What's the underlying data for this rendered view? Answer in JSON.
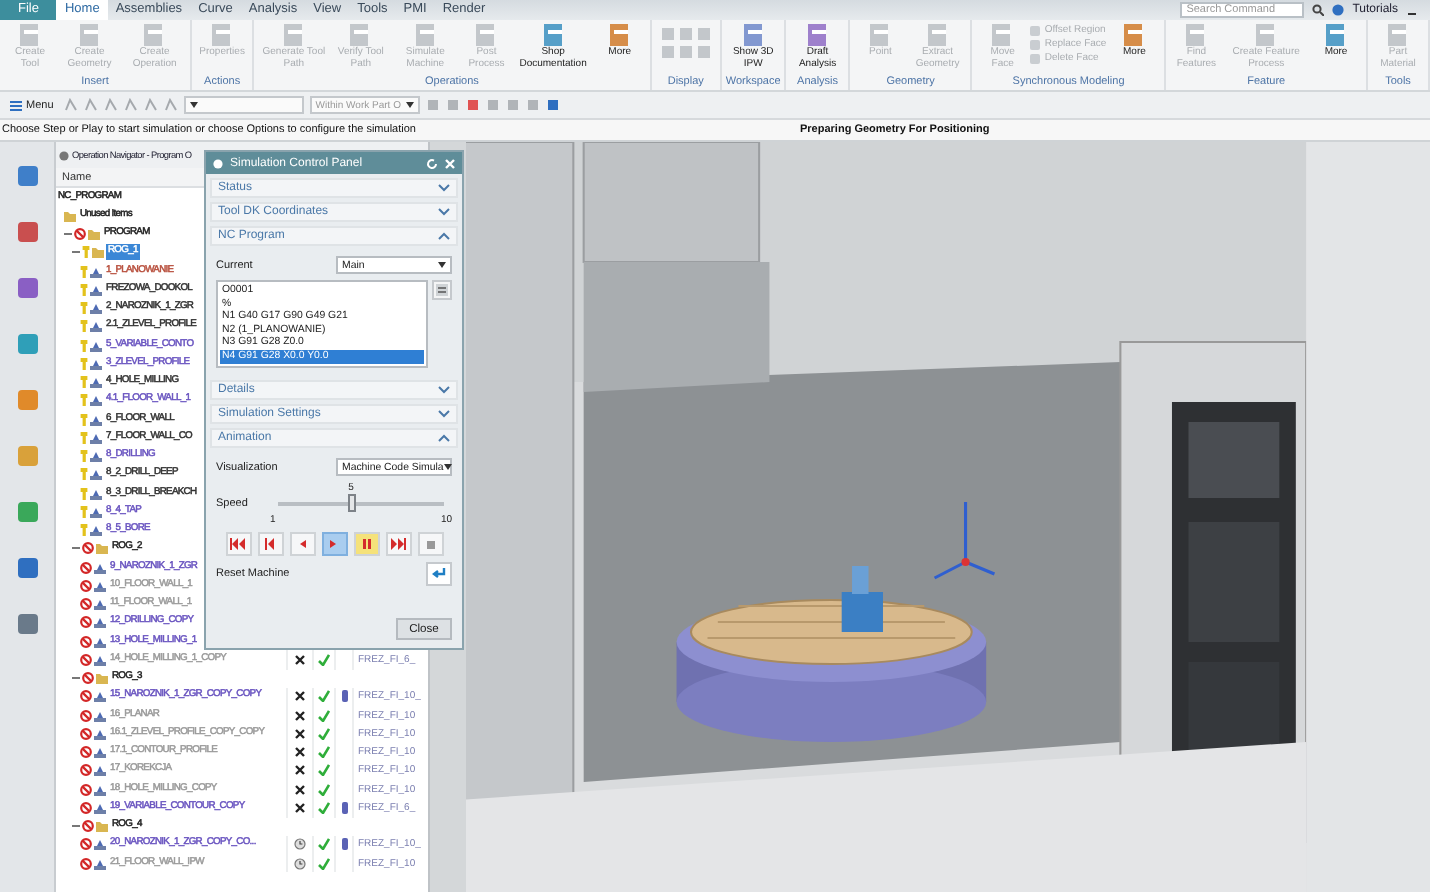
{
  "menu_tabs": [
    {
      "label": "File",
      "kind": "file",
      "selected": false
    },
    {
      "label": "Home",
      "kind": "tab",
      "selected": true
    },
    {
      "label": "Assemblies",
      "kind": "tab",
      "selected": false
    },
    {
      "label": "Curve",
      "kind": "tab",
      "selected": false
    },
    {
      "label": "Analysis",
      "kind": "tab",
      "selected": false
    },
    {
      "label": "View",
      "kind": "tab",
      "selected": false
    },
    {
      "label": "Tools",
      "kind": "tab",
      "selected": false
    },
    {
      "label": "PMI",
      "kind": "tab",
      "selected": false
    },
    {
      "label": "Render",
      "kind": "tab",
      "selected": false
    }
  ],
  "search": {
    "placeholder": "Search Command"
  },
  "user_menu": "Tutorials",
  "ribbon": {
    "groups": [
      {
        "label": "Insert",
        "buttons": [
          {
            "label": "Create Tool",
            "kind": "large",
            "disabled": true
          },
          {
            "label": "Create Geometry",
            "kind": "large",
            "disabled": true
          },
          {
            "label": "Create Operation",
            "kind": "large",
            "disabled": true
          }
        ]
      },
      {
        "label": "Actions",
        "buttons": [
          {
            "label": "Properties",
            "kind": "large",
            "disabled": true
          }
        ]
      },
      {
        "label": "Operations",
        "buttons": [
          {
            "label": "Generate Tool Path",
            "kind": "large",
            "disabled": true
          },
          {
            "label": "Verify Tool Path",
            "kind": "large",
            "disabled": true
          },
          {
            "label": "Simulate Machine",
            "kind": "large",
            "disabled": true
          },
          {
            "label": "Post Process",
            "kind": "large",
            "disabled": true
          },
          {
            "label": "Shop Documentation",
            "kind": "large",
            "disabled": false
          },
          {
            "label": "More",
            "kind": "large",
            "disabled": false
          }
        ]
      },
      {
        "label": "Display"
      },
      {
        "label": "Workspace",
        "buttons": [
          {
            "label": "Show 3D IPW",
            "kind": "large",
            "disabled": false
          }
        ]
      },
      {
        "label": "Analysis",
        "buttons": [
          {
            "label": "Draft Analysis",
            "kind": "large",
            "disabled": false
          }
        ]
      },
      {
        "label": "Geometry",
        "buttons": [
          {
            "label": "Point",
            "kind": "large",
            "disabled": true
          },
          {
            "label": "Extract Geometry",
            "kind": "large",
            "disabled": true
          }
        ]
      },
      {
        "label": "Synchronous Modeling",
        "buttons": [
          {
            "label": "Move Face",
            "kind": "large",
            "disabled": true
          },
          {
            "label": "Offset Region",
            "kind": "small",
            "disabled": true
          },
          {
            "label": "Replace Face",
            "kind": "small",
            "disabled": true
          },
          {
            "label": "Delete Face",
            "kind": "small",
            "disabled": true
          },
          {
            "label": "More",
            "kind": "large",
            "disabled": false
          }
        ]
      },
      {
        "label": "Feature",
        "buttons": [
          {
            "label": "Find Features",
            "kind": "large",
            "disabled": true
          },
          {
            "label": "Create Feature Process",
            "kind": "large",
            "disabled": true
          },
          {
            "label": "More",
            "kind": "large",
            "disabled": false
          }
        ]
      },
      {
        "label": "Tools",
        "buttons": [
          {
            "label": "Part Material",
            "kind": "large",
            "disabled": true
          }
        ]
      }
    ]
  },
  "toolbar": {
    "menu": "Menu",
    "filter": "Within Work Part O"
  },
  "status_bar": {
    "prompt": "Choose Step or Play to start simulation or choose Options to configure the simulation",
    "status": "Preparing Geometry For Positioning"
  },
  "navigator": {
    "title": "Operation Navigator - Program O",
    "column": "Name",
    "tree": [
      {
        "name": "NC_PROGRAM",
        "selected": false,
        "children": [
          {
            "name": "Unused Items",
            "kind": "folder",
            "selected": false
          },
          {
            "name": "PROGRAM",
            "kind": "folder",
            "failed": true,
            "expanded": true,
            "selected": false,
            "children": [
              {
                "name": "ROG_1",
                "kind": "group",
                "failed": false,
                "expanded": true,
                "selected": true,
                "children": [
                  {
                    "name": "1_PLANOWANIE",
                    "kind": "op",
                    "failed": false,
                    "color": "#b8503e",
                    "selected": false
                  },
                  {
                    "name": "FREZOWA_DOOKOL",
                    "kind": "op",
                    "failed": false,
                    "color": "#333333",
                    "selected": false
                  },
                  {
                    "name": "2_NAROZNIK_1_ZGR",
                    "kind": "op",
                    "failed": false,
                    "color": "#333333",
                    "selected": false
                  },
                  {
                    "name": "2.1_ZLEVEL_PROFILE",
                    "kind": "op",
                    "failed": false,
                    "color": "#333333",
                    "selected": false
                  },
                  {
                    "name": "5_VARIABLE_CONTO",
                    "kind": "op",
                    "failed": false,
                    "color": "#6a55c0",
                    "selected": false
                  },
                  {
                    "name": "3_ZLEVEL_PROFILE",
                    "kind": "op",
                    "failed": false,
                    "color": "#6a55c0",
                    "selected": false
                  },
                  {
                    "name": "4_HOLE_MILLING",
                    "kind": "op",
                    "failed": false,
                    "color": "#333333",
                    "selected": false
                  },
                  {
                    "name": "4.1_FLOOR_WALL_1",
                    "kind": "op",
                    "failed": false,
                    "color": "#6a55c0",
                    "selected": false
                  },
                  {
                    "name": "6_FLOOR_WALL",
                    "kind": "op",
                    "failed": false,
                    "color": "#333333",
                    "selected": false
                  },
                  {
                    "name": "7_FLOOR_WALL_CO",
                    "kind": "op",
                    "failed": false,
                    "color": "#333333",
                    "selected": false
                  },
                  {
                    "name": "8_DRILLING",
                    "kind": "op",
                    "failed": false,
                    "color": "#6a55c0",
                    "selected": false
                  },
                  {
                    "name": "8_2_DRILL_DEEP",
                    "kind": "op",
                    "failed": false,
                    "color": "#333333",
                    "selected": false
                  },
                  {
                    "name": "8_3_DRILL_BREAKCH",
                    "kind": "op",
                    "failed": false,
                    "color": "#333333",
                    "selected": false
                  },
                  {
                    "name": "8_4_TAP",
                    "kind": "op",
                    "failed": false,
                    "color": "#6a55c0",
                    "selected": false
                  },
                  {
                    "name": "8_5_BORE",
                    "kind": "op",
                    "failed": false,
                    "color": "#6a55c0",
                    "selected": false
                  }
                ]
              },
              {
                "name": "ROG_2",
                "kind": "group",
                "failed": true,
                "expanded": true,
                "selected": false,
                "children": [
                  {
                    "name": "9_NAROZNIK_1_ZGR",
                    "kind": "op",
                    "failed": true,
                    "color": "#6a55c0",
                    "selected": false
                  },
                  {
                    "name": "10_FLOOR_WALL_1",
                    "kind": "op",
                    "failed": true,
                    "color": "#9a9a9a",
                    "selected": false
                  },
                  {
                    "name": "11_FLOOR_WALL_1",
                    "kind": "op",
                    "failed": true,
                    "color": "#9a9a9a",
                    "selected": false
                  },
                  {
                    "name": "12_DRILLING_COPY",
                    "kind": "op",
                    "failed": true,
                    "color": "#6a55c0",
                    "selected": false
                  },
                  {
                    "name": "13_HOLE_MILLING_1",
                    "kind": "op",
                    "failed": true,
                    "color": "#6a55c0",
                    "selected": false
                  },
                  {
                    "name": "14_HOLE_MILLING_1_COPY",
                    "kind": "op",
                    "failed": true,
                    "color": "#9a9a9a",
                    "selected": false,
                    "columns": {
                      "queued": false,
                      "verified": true,
                      "tool_icon": false,
                      "tool": "FREZ_FI_6_"
                    }
                  }
                ]
              },
              {
                "name": "ROG_3",
                "kind": "group",
                "failed": true,
                "expanded": true,
                "selected": false,
                "children": [
                  {
                    "name": "15_NAROZNIK_1_ZGR_COPY_COPY",
                    "kind": "op",
                    "failed": true,
                    "color": "#6a55c0",
                    "selected": false,
                    "columns": {
                      "queued": false,
                      "verified": true,
                      "tool_icon": true,
                      "tool": "FREZ_FI_10_"
                    }
                  },
                  {
                    "name": "16_PLANAR",
                    "kind": "op",
                    "failed": true,
                    "color": "#9a9a9a",
                    "selected": false,
                    "columns": {
                      "queued": false,
                      "verified": true,
                      "tool_icon": false,
                      "tool": "FREZ_FI_10"
                    }
                  },
                  {
                    "name": "16.1_ZLEVEL_PROFILE_COPY_COPY",
                    "kind": "op",
                    "failed": true,
                    "color": "#9a9a9a",
                    "selected": false,
                    "columns": {
                      "queued": false,
                      "verified": true,
                      "tool_icon": false,
                      "tool": "FREZ_FI_10"
                    }
                  },
                  {
                    "name": "17.1_CONTOUR_PROFILE",
                    "kind": "op",
                    "failed": true,
                    "color": "#9a9a9a",
                    "selected": false,
                    "columns": {
                      "queued": false,
                      "verified": true,
                      "tool_icon": false,
                      "tool": "FREZ_FI_10"
                    }
                  },
                  {
                    "name": "17_KOREKCJA",
                    "kind": "op",
                    "failed": true,
                    "color": "#9a9a9a",
                    "selected": false,
                    "columns": {
                      "queued": false,
                      "verified": true,
                      "tool_icon": false,
                      "tool": "FREZ_FI_10"
                    }
                  },
                  {
                    "name": "18_HOLE_MILLING_COPY",
                    "kind": "op",
                    "failed": true,
                    "color": "#9a9a9a",
                    "selected": false,
                    "columns": {
                      "queued": false,
                      "verified": true,
                      "tool_icon": false,
                      "tool": "FREZ_FI_10"
                    }
                  },
                  {
                    "name": "19_VARIABLE_CONTOUR_COPY",
                    "kind": "op",
                    "failed": true,
                    "color": "#6a55c0",
                    "selected": false,
                    "columns": {
                      "queued": false,
                      "verified": true,
                      "tool_icon": true,
                      "tool": "FREZ_FI_6_"
                    }
                  }
                ]
              },
              {
                "name": "ROG_4",
                "kind": "group",
                "failed": true,
                "expanded": true,
                "selected": false,
                "children": [
                  {
                    "name": "20_NAROZNIK_1_ZGR_COPY_CO...",
                    "kind": "op",
                    "failed": true,
                    "color": "#6a55c0",
                    "selected": false,
                    "columns": {
                      "queued": true,
                      "verified": true,
                      "tool_icon": true,
                      "tool": "FREZ_FI_10_"
                    }
                  },
                  {
                    "name": "21_FLOOR_WALL_IPW",
                    "kind": "op",
                    "failed": true,
                    "color": "#9a9a9a",
                    "selected": false,
                    "columns": {
                      "queued": true,
                      "verified": true,
                      "tool_icon": false,
                      "tool": "FREZ_FI_10"
                    }
                  }
                ]
              }
            ]
          }
        ]
      }
    ]
  },
  "dialog": {
    "title": "Simulation Control Panel",
    "close_label": "Close",
    "sections": [
      {
        "title": "Status",
        "expanded": false
      },
      {
        "title": "Tool DK Coordinates",
        "expanded": false
      },
      {
        "title": "NC Program",
        "kind": "nc_program",
        "expanded": true,
        "current_label": "Current",
        "current_value": "Main",
        "lines": [
          {
            "text": "O0001",
            "selected": false
          },
          {
            "text": "%",
            "selected": false
          },
          {
            "text": "N1 G40 G17 G90 G49 G21",
            "selected": false
          },
          {
            "text": "N2 (1_PLANOWANIE)",
            "selected": false
          },
          {
            "text": "N3 G91 G28 Z0.0",
            "selected": false
          },
          {
            "text": "N4 G91 G28 X0.0 Y0.0",
            "selected": true
          }
        ]
      },
      {
        "title": "Details",
        "expanded": false
      },
      {
        "title": "Simulation Settings",
        "expanded": false
      },
      {
        "title": "Animation",
        "kind": "animation",
        "expanded": true,
        "visualization_label": "Visualization",
        "visualization_value": "Machine Code Simula",
        "speed_label": "Speed",
        "speed_value": "5",
        "speed_min": "1",
        "speed_max": "10",
        "level": 0.44,
        "controls": [
          {
            "kind": "to_start",
            "selected": false,
            "hovered": false
          },
          {
            "kind": "step_back",
            "selected": false,
            "hovered": false
          },
          {
            "kind": "play_back",
            "selected": false,
            "hovered": false
          },
          {
            "kind": "play",
            "selected": true,
            "hovered": false
          },
          {
            "kind": "pause",
            "selected": false,
            "hovered": true
          },
          {
            "kind": "to_end",
            "selected": false,
            "hovered": false
          },
          {
            "kind": "stop",
            "selected": false,
            "hovered": false
          }
        ],
        "reset_label": "Reset Machine"
      }
    ]
  }
}
